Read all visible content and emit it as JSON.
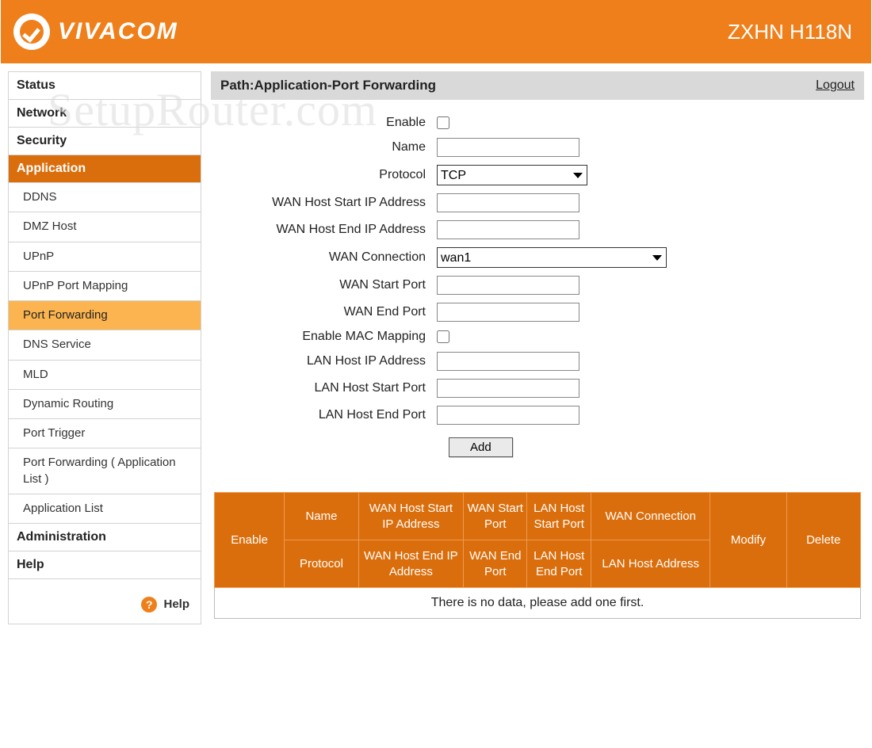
{
  "watermark": "SetupRouter.com",
  "header": {
    "brand": "VIVACOM",
    "model": "ZXHN H118N"
  },
  "sidebar": {
    "items": [
      {
        "label": "Status",
        "type": "top"
      },
      {
        "label": "Network",
        "type": "top"
      },
      {
        "label": "Security",
        "type": "top"
      },
      {
        "label": "Application",
        "type": "top",
        "active": true
      },
      {
        "label": "DDNS",
        "type": "sub"
      },
      {
        "label": "DMZ Host",
        "type": "sub"
      },
      {
        "label": "UPnP",
        "type": "sub"
      },
      {
        "label": "UPnP Port Mapping",
        "type": "sub"
      },
      {
        "label": "Port Forwarding",
        "type": "sub",
        "active": true
      },
      {
        "label": "DNS Service",
        "type": "sub"
      },
      {
        "label": "MLD",
        "type": "sub"
      },
      {
        "label": "Dynamic Routing",
        "type": "sub"
      },
      {
        "label": "Port Trigger",
        "type": "sub"
      },
      {
        "label": "Port Forwarding ( Application List )",
        "type": "sub"
      },
      {
        "label": "Application List",
        "type": "sub"
      },
      {
        "label": "Administration",
        "type": "top"
      },
      {
        "label": "Help",
        "type": "top"
      }
    ],
    "help_label": "Help"
  },
  "path": {
    "text": "Path:Application-Port Forwarding",
    "logout": "Logout"
  },
  "form": {
    "enable": "Enable",
    "name": "Name",
    "protocol": "Protocol",
    "protocol_value": "TCP",
    "wan_start_ip": "WAN Host Start IP Address",
    "wan_end_ip": "WAN Host End IP Address",
    "wan_conn": "WAN Connection",
    "wan_conn_value": "wan1",
    "wan_start_port": "WAN Start Port",
    "wan_end_port": "WAN End Port",
    "mac_mapping": "Enable MAC Mapping",
    "lan_ip": "LAN Host IP Address",
    "lan_start_port": "LAN Host Start Port",
    "lan_end_port": "LAN Host End Port",
    "add": "Add"
  },
  "table": {
    "headers": {
      "enable": "Enable",
      "name": "Name",
      "protocol": "Protocol",
      "wan_start_ip": "WAN Host Start IP Address",
      "wan_end_ip": "WAN Host End IP Address",
      "wan_start_port": "WAN Start Port",
      "wan_end_port": "WAN End Port",
      "lan_start_port": "LAN Host Start Port",
      "lan_end_port": "LAN Host End Port",
      "wan_conn": "WAN Connection",
      "lan_addr": "LAN Host Address",
      "modify": "Modify",
      "delete": "Delete"
    },
    "empty": "There is no data, please add one first."
  }
}
